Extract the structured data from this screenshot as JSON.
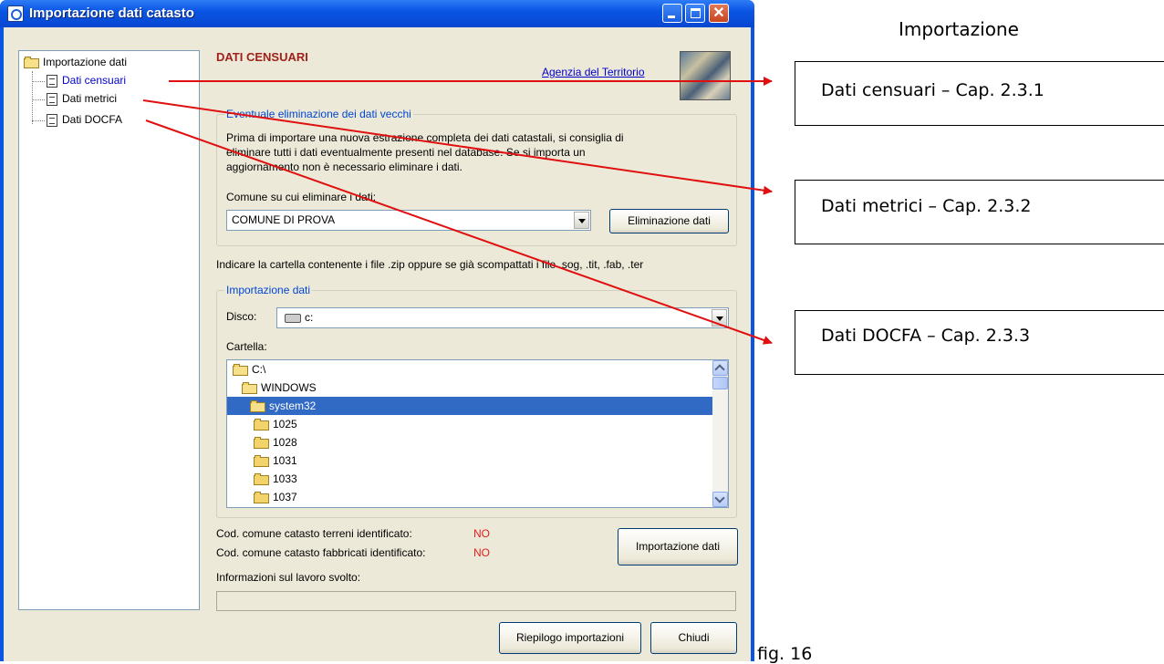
{
  "window": {
    "title": "Importazione dati catasto"
  },
  "tree": {
    "root": "Importazione dati",
    "items": [
      {
        "label": "Dati censuari",
        "selected": true
      },
      {
        "label": "Dati metrici",
        "selected": false
      },
      {
        "label": "Dati DOCFA",
        "selected": false
      }
    ]
  },
  "header": {
    "title": "DATI CENSUARI",
    "agency_link": "Agenzia del Territorio"
  },
  "elimination": {
    "group_label": "Eventuale eliminazione dei dati vecchi",
    "desc_line1": "Prima di importare una nuova estrazione completa dei dati catastali, si consiglia di",
    "desc_line2": "eliminare tutti i dati eventualmente presenti nel database. Se si importa un",
    "desc_line3": "aggiornamento non è necessario eliminare i dati.",
    "comune_label": "Comune su cui eliminare i dati:",
    "comune_value": "COMUNE DI PROVA",
    "button": "Eliminazione dati"
  },
  "folder_hint": "Indicare la cartella contenente i file .zip  oppure se già scompattati i file  .sog, .tit, .fab, .ter",
  "import": {
    "group_label": "Importazione dati",
    "disk_label": "Disco:",
    "disk_value": "c:",
    "folder_label": "Cartella:",
    "folders": [
      {
        "name": "C:\\",
        "selected": false
      },
      {
        "name": "WINDOWS",
        "selected": false
      },
      {
        "name": "system32",
        "selected": true
      },
      {
        "name": "1025",
        "selected": false
      },
      {
        "name": "1028",
        "selected": false
      },
      {
        "name": "1031",
        "selected": false
      },
      {
        "name": "1033",
        "selected": false
      },
      {
        "name": "1037",
        "selected": false
      }
    ]
  },
  "status": {
    "terreni_label": "Cod. comune catasto terreni identificato:",
    "terreni_value": "NO",
    "fabbricati_label": "Cod. comune catasto fabbricati identificato:",
    "fabbricati_value": "NO",
    "import_button": "Importazione dati",
    "info_label": "Informazioni sul lavoro svolto:"
  },
  "footer": {
    "summary_button": "Riepilogo importazioni",
    "close_button": "Chiudi"
  },
  "annotations": {
    "heading": "Importazione",
    "callouts": [
      "Dati censuari – Cap. 2.3.1",
      "Dati metrici – Cap. 2.3.2",
      "Dati DOCFA – Cap. 2.3.3"
    ],
    "figure_caption": "fig. 16"
  },
  "colors": {
    "title_bar": "#0a55e4",
    "header_red": "#a0201c",
    "selection": "#316ac5",
    "status_red": "#e0201c"
  }
}
